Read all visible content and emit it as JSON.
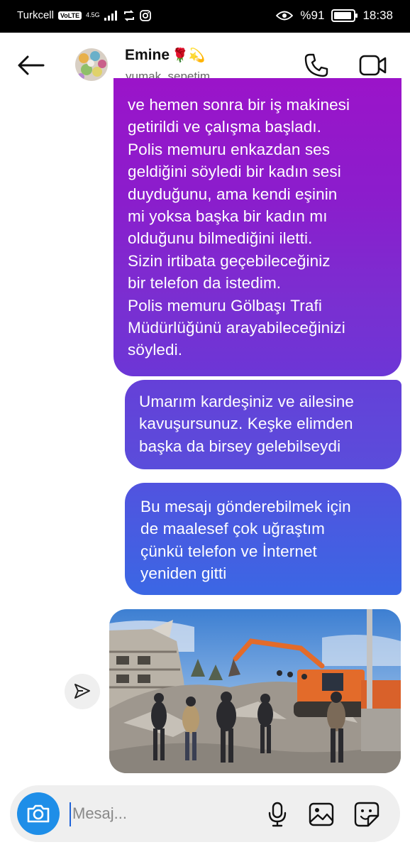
{
  "status_bar": {
    "carrier": "Turkcell",
    "volte": "VoLTE",
    "network": "4.5G",
    "battery_pct": "%91",
    "battery_level": 0.91,
    "time": "18:38"
  },
  "header": {
    "contact_name": "Emine",
    "name_emojis": "🌹💫",
    "username": "yumak_sepetim"
  },
  "messages": [
    {
      "lines": [
        "ve hemen sonra bir iş makinesi",
        "getirildi ve çalışma başladı.",
        "Polis memuru enkazdan ses",
        "geldiğini söyledi bir kadın sesi",
        "duyduğunu, ama kendi eşinin",
        "mi yoksa başka bir kadın mı",
        "olduğunu bilmediğini iletti.",
        "Sizin irtibata geçebileceğiniz",
        "bir telefon da istedim.",
        "Polis memuru Gölbaşı Trafi",
        "Müdürlüğünü arayabileceğinizi",
        "söyledi."
      ]
    },
    {
      "lines": [
        "Umarım kardeşiniz ve ailesine",
        "kavuşursunuz. Keşke elimden",
        "başka da birsey gelebilseydi"
      ]
    },
    {
      "lines": [
        "Bu mesajı gönderebilmek için",
        "de maalesef çok uğraştım",
        "çünkü telefon ve İnternet",
        "yeniden gitti"
      ]
    }
  ],
  "composer": {
    "placeholder": "Mesaj..."
  },
  "colors": {
    "accent": "#1e8ee8",
    "bubble_top": "#9b14c9",
    "bubble_bottom": "#3b67e4"
  },
  "icons": [
    "back-arrow-icon",
    "phone-icon",
    "video-camera-icon",
    "send-icon",
    "camera-icon",
    "microphone-icon",
    "gallery-icon",
    "sticker-icon"
  ]
}
